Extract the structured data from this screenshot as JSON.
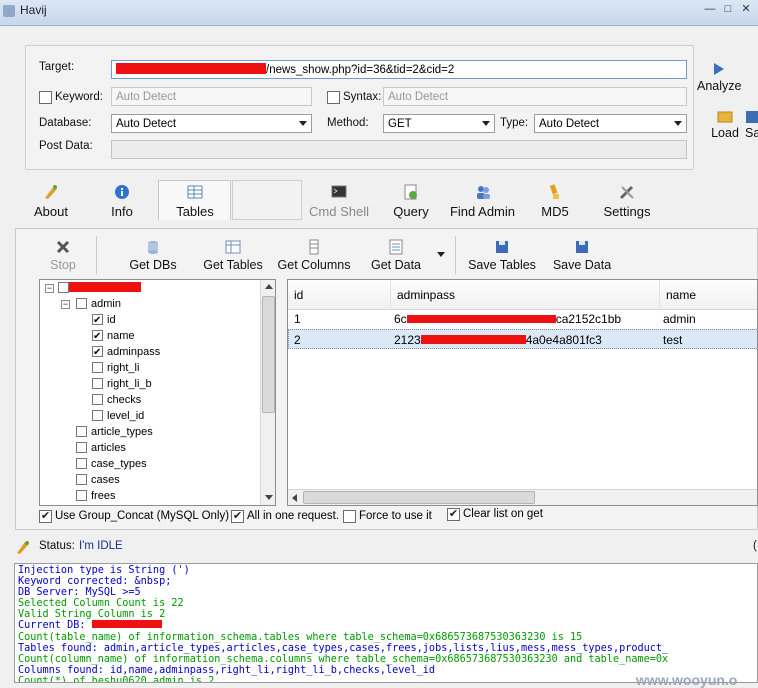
{
  "window": {
    "title": "Havij",
    "controls": [
      "—",
      "□",
      "✕"
    ]
  },
  "target_group": {
    "target_label": "Target:",
    "target_value": "/news_show.php?id=36&tid=2&cid=2",
    "keyword_label": "Keyword:",
    "keyword_placeholder": "Auto Detect",
    "syntax_label": "Syntax:",
    "syntax_placeholder": "Auto Detect",
    "database_label": "Database:",
    "database_value": "Auto Detect",
    "method_label": "Method:",
    "method_value": "GET",
    "type_label": "Type:",
    "type_value": "Auto Detect",
    "postdata_label": "Post Data:",
    "postdata_value": ""
  },
  "side_actions": {
    "analyze_label": "Analyze",
    "load_label": "Load",
    "save_label": "Sa"
  },
  "main_toolbar": [
    {
      "label": "About",
      "icon": "about-icon"
    },
    {
      "label": "Info",
      "icon": "info-icon"
    },
    {
      "label": "Tables",
      "icon": "tables-icon"
    },
    {
      "label": "Cmd Shell",
      "icon": "cmd-shell-icon"
    },
    {
      "label": "Query",
      "icon": "query-icon"
    },
    {
      "label": "Find Admin",
      "icon": "find-admin-icon"
    },
    {
      "label": "MD5",
      "icon": "md5-icon"
    },
    {
      "label": "Settings",
      "icon": "settings-icon"
    }
  ],
  "sub_toolbar": [
    {
      "label": "Stop",
      "icon": "stop-icon"
    },
    {
      "label": "Get DBs",
      "icon": "database-icon"
    },
    {
      "label": "Get Tables",
      "icon": "table-icon"
    },
    {
      "label": "Get Columns",
      "icon": "columns-icon"
    },
    {
      "label": "Get Data",
      "icon": "data-icon"
    },
    {
      "label": "Save Tables",
      "icon": "floppy-icon"
    },
    {
      "label": "Save Data",
      "icon": "floppy-icon"
    }
  ],
  "tree": {
    "table": "admin",
    "columns": [
      {
        "name": "id",
        "checked": true
      },
      {
        "name": "name",
        "checked": true
      },
      {
        "name": "adminpass",
        "checked": true
      },
      {
        "name": "right_li",
        "checked": false
      },
      {
        "name": "right_li_b",
        "checked": false
      },
      {
        "name": "checks",
        "checked": false
      },
      {
        "name": "level_id",
        "checked": false
      }
    ],
    "tables": [
      "article_types",
      "articles",
      "case_types",
      "cases",
      "frees"
    ]
  },
  "grid": {
    "headers": [
      "id",
      "adminpass",
      "name"
    ],
    "rows": [
      {
        "id": "1",
        "pass_start": "6c",
        "pass_end": "ca2152c1bb",
        "name": "admin"
      },
      {
        "id": "2",
        "pass_start": "2123",
        "pass_end": "4a0e4a801fc3",
        "name": "test"
      }
    ]
  },
  "options": [
    {
      "label": "Use Group_Concat (MySQL Only)",
      "checked": true
    },
    {
      "label": "All in one request.",
      "checked": true
    },
    {
      "label": "Force to use it",
      "checked": false
    },
    {
      "label": "Clear list on get",
      "checked": true
    }
  ],
  "status": {
    "label": "Status:",
    "value": "I'm IDLE"
  },
  "log": [
    {
      "text": "Injection type is String (')",
      "color": "#0000cc"
    },
    {
      "text": "Keyword corrected: &nbsp;",
      "color": "#0000cc"
    },
    {
      "text": "DB Server: MySQL >=5",
      "color": "#0000cc"
    },
    {
      "text": "Selected Column Count is 22",
      "color": "#009900"
    },
    {
      "text": "Valid String Column is 2",
      "color": "#009900"
    },
    {
      "text": "Current DB: ",
      "color": "#0000cc"
    },
    {
      "text": "Count(table_name) of information_schema.tables where table_schema=0x686573687530363230 is 15",
      "color": "#009900"
    },
    {
      "text": "Tables found: admin,article_types,articles,case_types,cases,frees,jobs,lists,lius,mess,mess_types,product_",
      "color": "#0000cc"
    },
    {
      "text": "Count(column_name) of information_schema.columns where table_schema=0x686573687530363230 and table_name=0x",
      "color": "#009900"
    },
    {
      "text": "Columns found: id,name,adminpass,right_li,right_li_b,checks,level_id",
      "color": "#0000cc"
    },
    {
      "text": "Count(*) of heshu0620.admin is 2",
      "color": "#009900"
    }
  ],
  "watermark": "www.wooyun.o"
}
